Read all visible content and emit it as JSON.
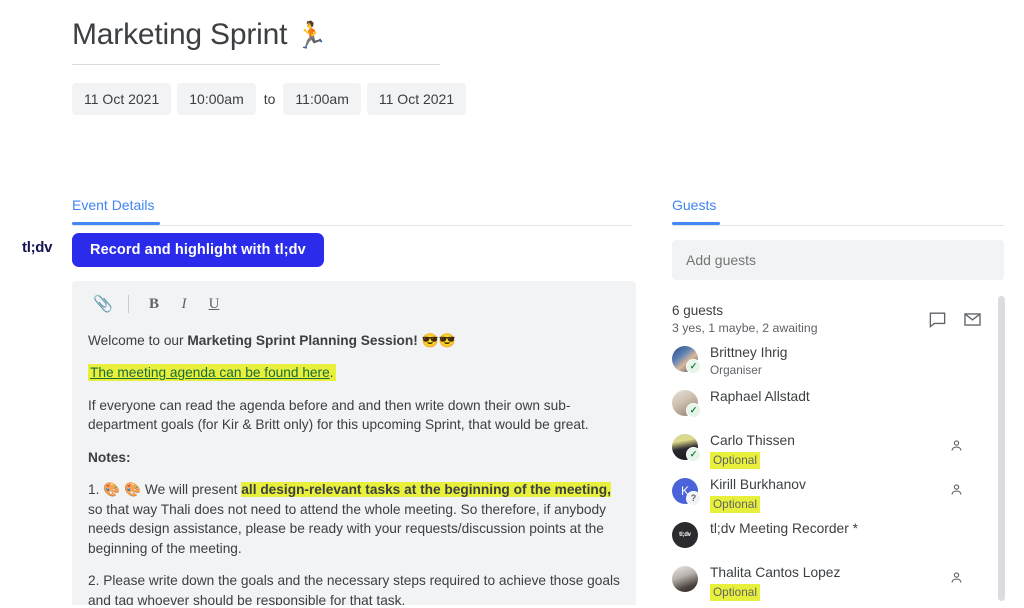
{
  "header": {
    "title": "Marketing Sprint",
    "title_emoji": "🏃",
    "start_date": "11 Oct 2021",
    "start_time": "10:00am",
    "separator": "to",
    "end_time": "11:00am",
    "end_date": "11 Oct 2021"
  },
  "tabs": {
    "event_details": "Event Details",
    "guests": "Guests"
  },
  "tldv": {
    "logo": "tl;dv",
    "record_button": "Record and highlight with tl;dv",
    "accent_color": "#2b2beb"
  },
  "editor": {
    "toolbar": {
      "attach": "📎",
      "bold": "B",
      "italic": "I",
      "underline": "U"
    },
    "paragraphs": {
      "welcome_prefix": "Welcome to our ",
      "welcome_bold": "Marketing Sprint Planning Session!",
      "welcome_emoji": "😎😎",
      "agenda_link": "The meeting agenda can be found here",
      "agenda_period": ".",
      "read_agenda": "If everyone can read the agenda before and and then write down their own sub-department goals (for Kir & Britt only) for this upcoming Sprint, that would be great.",
      "notes_label": "Notes:",
      "note1_num": "1.",
      "note1_emoji": "🎨 🎨",
      "note1_pre": " We will present ",
      "note1_hl": "all design-relevant tasks at the beginning of the meeting,",
      "note1_post": " so that way Thali does not need to attend the whole meeting. So therefore, if anybody needs design assistance, please be ready with your requests/discussion points at the beginning of the meeting.",
      "note2": "2. Please write down the goals and the necessary steps required to achieve those goals and tag whoever should be responsible for that task."
    },
    "highlight_color": "#e8f03c"
  },
  "guests": {
    "add_placeholder": "Add guests",
    "count_label": "6 guests",
    "status_summary": "3 yes, 1 maybe, 2 awaiting",
    "list": [
      {
        "name": "Brittney Ihrig",
        "sub": "Organiser",
        "sub_highlight": false,
        "rsvp": "yes",
        "badge": "✓",
        "avatar_class": "av-brittney",
        "avatar_text": "",
        "has_person_icon": false
      },
      {
        "name": "Raphael Allstadt",
        "sub": "",
        "sub_highlight": false,
        "rsvp": "yes",
        "badge": "✓",
        "avatar_class": "av-raphael",
        "avatar_text": "",
        "has_person_icon": false
      },
      {
        "name": "Carlo Thissen",
        "sub": "Optional",
        "sub_highlight": true,
        "rsvp": "yes",
        "badge": "✓",
        "avatar_class": "av-carlo",
        "avatar_text": "",
        "has_person_icon": true
      },
      {
        "name": "Kirill Burkhanov",
        "sub": "Optional",
        "sub_highlight": true,
        "rsvp": "maybe",
        "badge": "?",
        "avatar_class": "av-kirill",
        "avatar_text": "K",
        "has_person_icon": true
      },
      {
        "name": "tl;dv Meeting Recorder *",
        "sub": "",
        "sub_highlight": false,
        "rsvp": "awaiting",
        "badge": "",
        "avatar_class": "av-tldv",
        "avatar_text": "tl;dv",
        "has_person_icon": false
      },
      {
        "name": "Thalita Cantos Lopez",
        "sub": "Optional",
        "sub_highlight": true,
        "rsvp": "awaiting",
        "badge": "",
        "avatar_class": "av-thalita",
        "avatar_text": "",
        "has_person_icon": true
      }
    ]
  }
}
